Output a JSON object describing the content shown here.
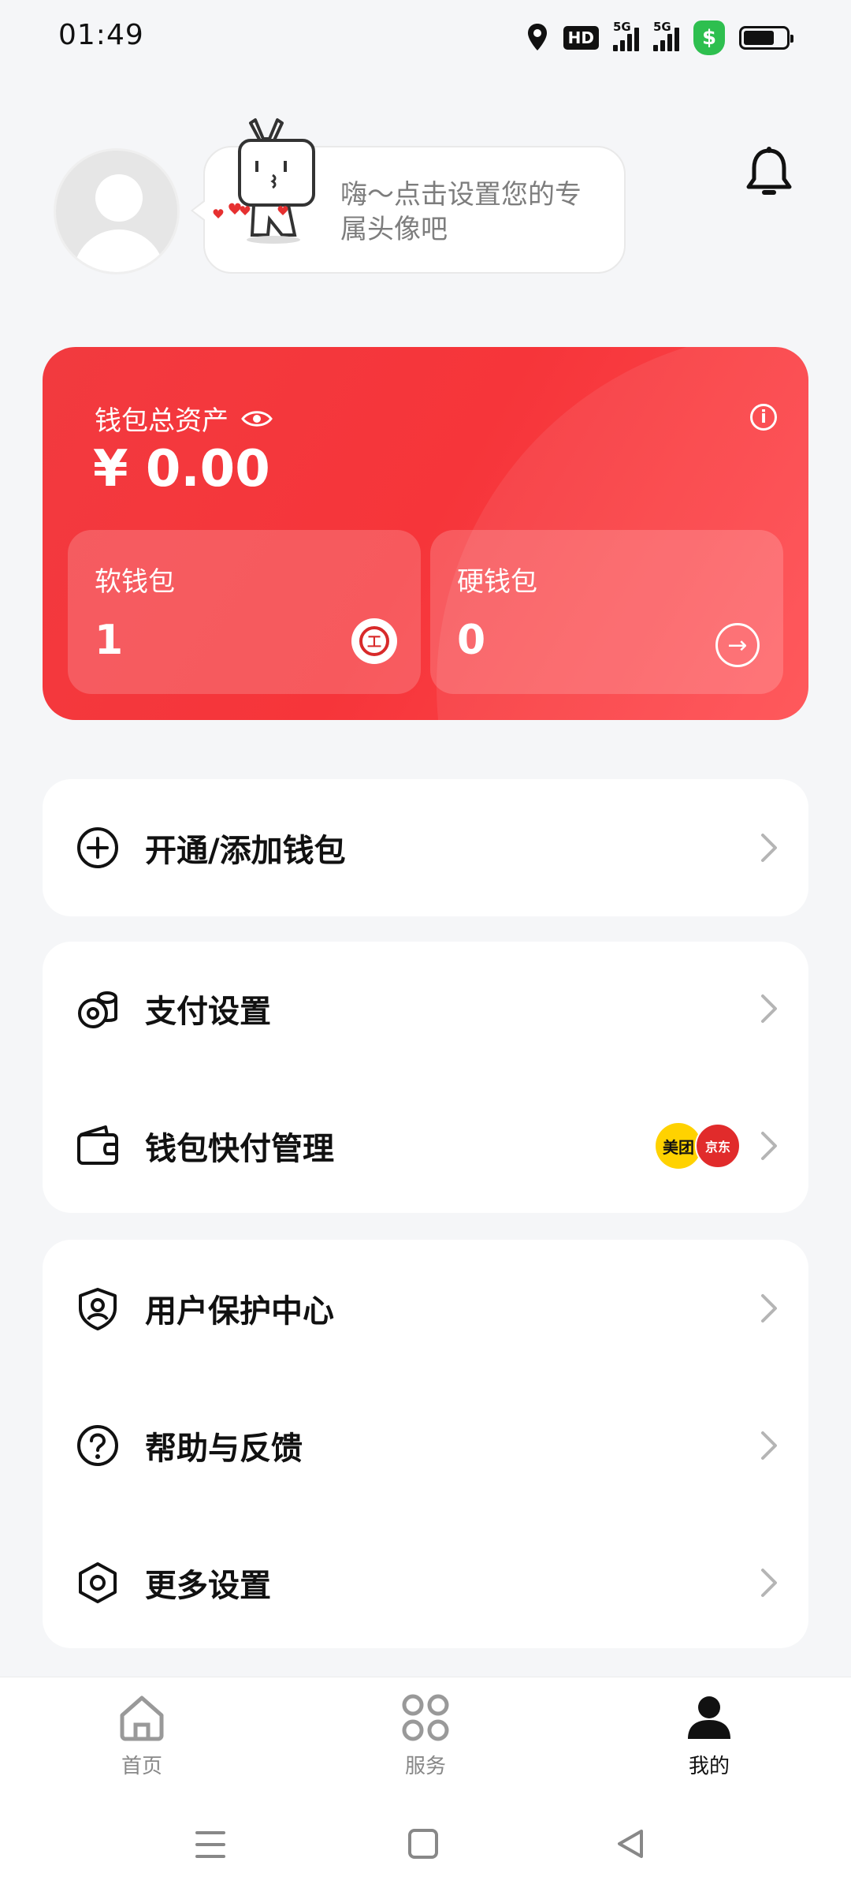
{
  "status_bar": {
    "time": "01:49",
    "network_label_1": "5G",
    "network_label_2": "5G",
    "hd_label": "HD",
    "icons": [
      "location-icon",
      "hd-voice-icon",
      "signal-icon",
      "signal-icon",
      "security-shield-icon",
      "battery-icon"
    ],
    "battery_level": 0.66
  },
  "header": {
    "avatar_prompt": "嗨～点击设置您的专属头像吧",
    "icons": [
      "avatar-placeholder-icon",
      "mascot-icon",
      "bell-icon"
    ]
  },
  "wallet": {
    "title": "钱包总资产",
    "amount": "¥ 0.00",
    "soft_wallet": {
      "label": "软钱包",
      "count": "1",
      "icon": "icbc-logo-icon"
    },
    "hard_wallet": {
      "label": "硬钱包",
      "count": "0",
      "icon": "arrow-right-circle-icon"
    },
    "colors": {
      "primary": "#f23a3f",
      "accent": "#ff4b4f"
    }
  },
  "menu": {
    "group1": [
      {
        "label": "开通/添加钱包",
        "icon": "plus-circle-icon"
      }
    ],
    "group2": [
      {
        "label": "支付设置",
        "icon": "coins-icon"
      },
      {
        "label": "钱包快付管理",
        "icon": "wallet-icon",
        "badges": [
          "美团",
          "京东"
        ]
      }
    ],
    "group3": [
      {
        "label": "用户保护中心",
        "icon": "shield-user-icon"
      },
      {
        "label": "帮助与反馈",
        "icon": "question-circle-icon"
      },
      {
        "label": "更多设置",
        "icon": "hexagon-settings-icon"
      }
    ]
  },
  "bottom_nav": {
    "items": [
      {
        "label": "首页",
        "icon": "home-icon",
        "active": false
      },
      {
        "label": "服务",
        "icon": "services-grid-icon",
        "active": false
      },
      {
        "label": "我的",
        "icon": "person-icon",
        "active": true
      }
    ]
  },
  "system_nav": [
    "menu-icon",
    "home-square-icon",
    "back-triangle-icon"
  ]
}
